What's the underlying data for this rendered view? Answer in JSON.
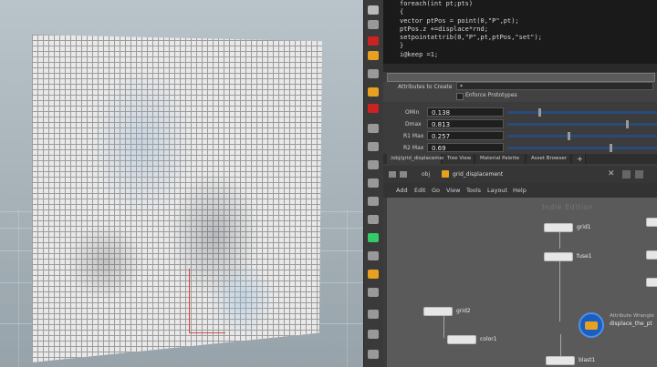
{
  "code": {
    "lines": [
      "foreach(int pt;pts)",
      "{",
      "    vector ptPos = point(0,\"P\",pt);",
      "    ptPos.z +=displace*rnd;",
      "    setpointattrib(0,\"P\",pt,ptPos,\"set\");",
      "}",
      "i@keep =1;"
    ]
  },
  "params": {
    "attributes_label": "Attributes to Create",
    "attributes_value": "*",
    "enforce_label": "Enforce Prototypes",
    "rows": [
      {
        "label": "OMin",
        "value": "0.138"
      },
      {
        "label": "Dmax",
        "value": "0.813"
      },
      {
        "label": "R1 Max",
        "value": "0.257"
      },
      {
        "label": "R2 Max",
        "value": "0.69"
      }
    ]
  },
  "tabs": [
    "/obj/grid_displacement",
    "Tree View",
    "Material Palette",
    "Asset Browser",
    "+"
  ],
  "path": {
    "root": "obj",
    "node": "grid_displacement"
  },
  "menu": [
    "Add",
    "Edit",
    "Go",
    "View",
    "Tools",
    "Layout",
    "Help"
  ],
  "network": {
    "watermark": "Indie Edition",
    "nodes": {
      "grid1": "grid1",
      "fuse1": "fuse1",
      "grid2": "grid2",
      "color1": "color1",
      "wrangle_type": "Attribute Wrangle",
      "wrangle_name": "displace_the_pt",
      "blast1": "blast1"
    }
  },
  "colors": {
    "accent": "#e8a020",
    "slider": "#2a4a7a"
  }
}
